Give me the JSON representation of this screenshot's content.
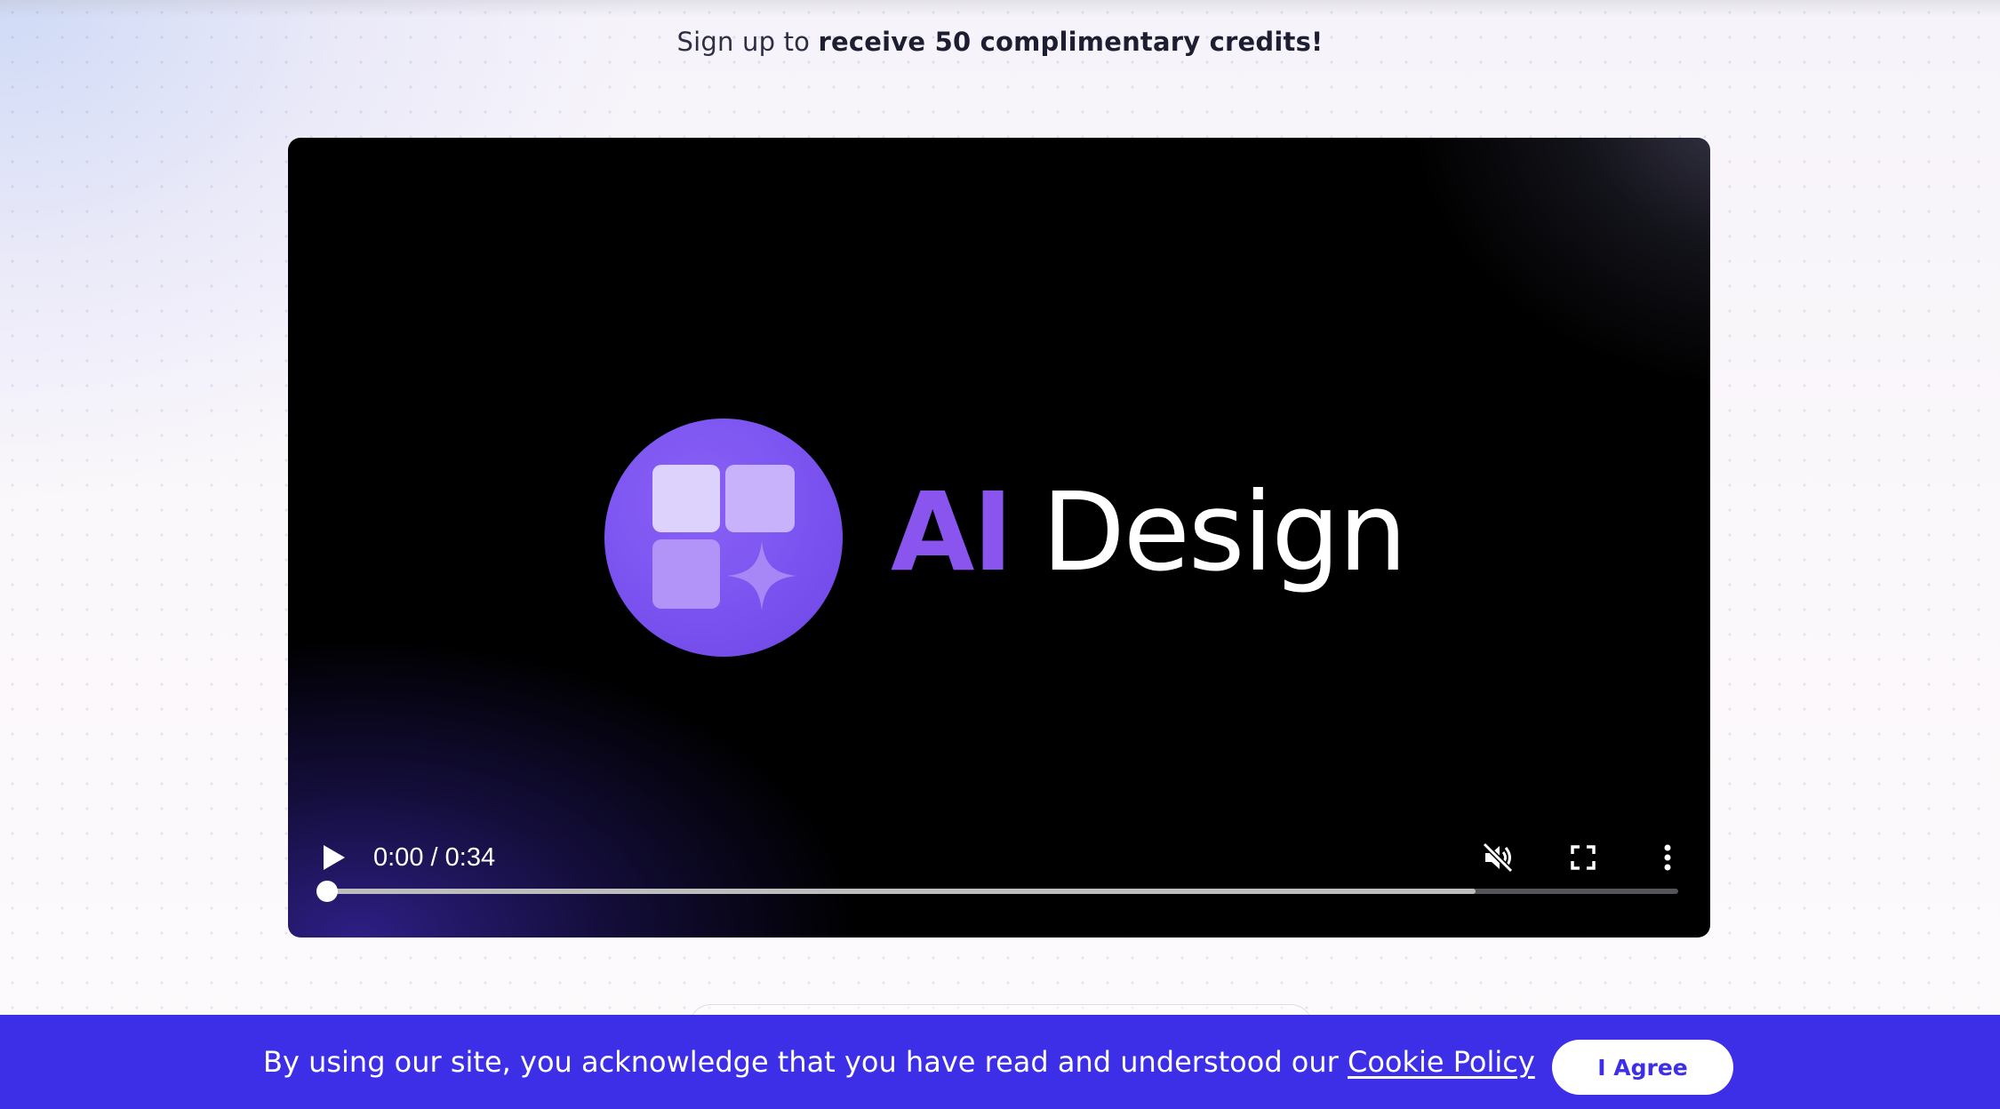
{
  "promo": {
    "prefix": "Sign up to",
    "highlight": "receive 50 complimentary credits!"
  },
  "video": {
    "brand_ai": "AI",
    "brand_name": "Design",
    "current_time": "0:00",
    "separator": "/",
    "duration": "0:34",
    "played_fraction": 0.0,
    "buffered_fraction": 0.85,
    "muted": true,
    "logo_colors": {
      "circle": "#7a52ef",
      "tile_light": "#ddd2fc",
      "tile_mid": "#c7b2fb",
      "tile_dark": "#b294f8"
    },
    "icons": {
      "play": "play-icon",
      "mute": "volume-muted-icon",
      "fullscreen": "fullscreen-icon",
      "more": "more-vertical-icon"
    }
  },
  "cookie": {
    "message": "By using our site, you acknowledge that you have read and understood our",
    "link_label": "Cookie Policy",
    "agree_label": "I Agree",
    "bar_color": "#3d2ee8"
  }
}
